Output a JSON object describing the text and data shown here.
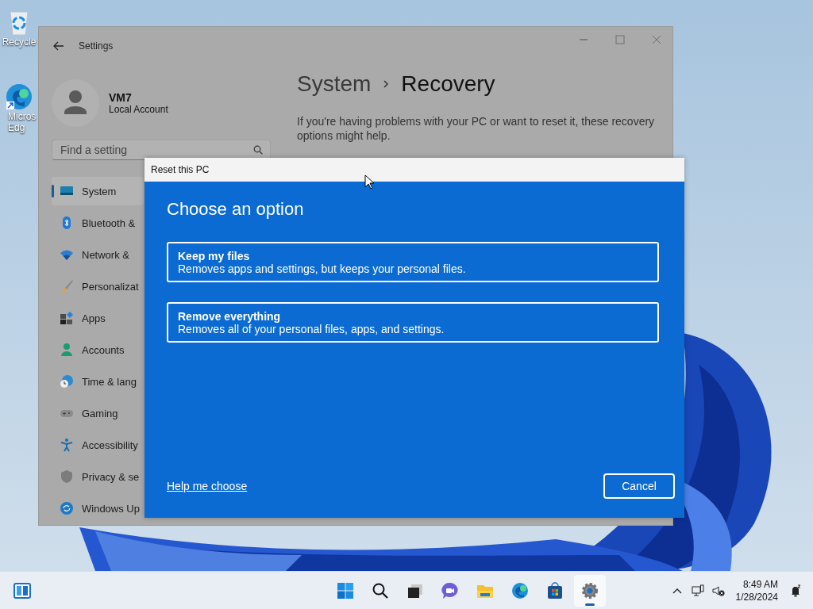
{
  "desktop": {
    "icons": [
      {
        "kind": "recycle",
        "lines": [
          "Recycle"
        ]
      },
      {
        "kind": "edge",
        "lines": [
          "Micros",
          "Edg"
        ]
      }
    ]
  },
  "settings": {
    "title": "Settings",
    "user": {
      "name": "VM7",
      "account": "Local Account"
    },
    "search": {
      "placeholder": "Find a setting"
    },
    "nav": [
      {
        "kind": "system",
        "label": "System",
        "selected": true
      },
      {
        "kind": "bluetooth",
        "label": "Bluetooth &",
        "selected": false
      },
      {
        "kind": "network",
        "label": "Network &",
        "selected": false
      },
      {
        "kind": "personalization",
        "label": "Personalizat",
        "selected": false
      },
      {
        "kind": "apps",
        "label": "Apps",
        "selected": false
      },
      {
        "kind": "accounts",
        "label": "Accounts",
        "selected": false
      },
      {
        "kind": "time",
        "label": "Time & lang",
        "selected": false
      },
      {
        "kind": "gaming",
        "label": "Gaming",
        "selected": false
      },
      {
        "kind": "accessibility",
        "label": "Accessibility",
        "selected": false
      },
      {
        "kind": "privacy",
        "label": "Privacy & se",
        "selected": false
      },
      {
        "kind": "update",
        "label": "Windows Up",
        "selected": false
      }
    ],
    "breadcrumb": [
      "System",
      "Recovery"
    ],
    "description": "If you're having problems with your PC or want to reset it, these recovery options might help."
  },
  "dialog": {
    "title": "Reset this PC",
    "heading": "Choose an option",
    "options": [
      {
        "title": "Keep my files",
        "description": "Removes apps and settings, but keeps your personal files."
      },
      {
        "title": "Remove everything",
        "description": "Removes all of your personal files, apps, and settings."
      }
    ],
    "link": "Help me choose",
    "button": "Cancel"
  },
  "taskbar": {
    "apps": [
      {
        "kind": "start",
        "active": false
      },
      {
        "kind": "search",
        "active": false
      },
      {
        "kind": "taskview",
        "active": false
      },
      {
        "kind": "chat",
        "active": false
      },
      {
        "kind": "explorer",
        "active": false
      },
      {
        "kind": "edge",
        "active": false
      },
      {
        "kind": "store",
        "active": false
      },
      {
        "kind": "settings",
        "active": true
      }
    ],
    "time": "8:49 AM",
    "date": "1/28/2024"
  }
}
